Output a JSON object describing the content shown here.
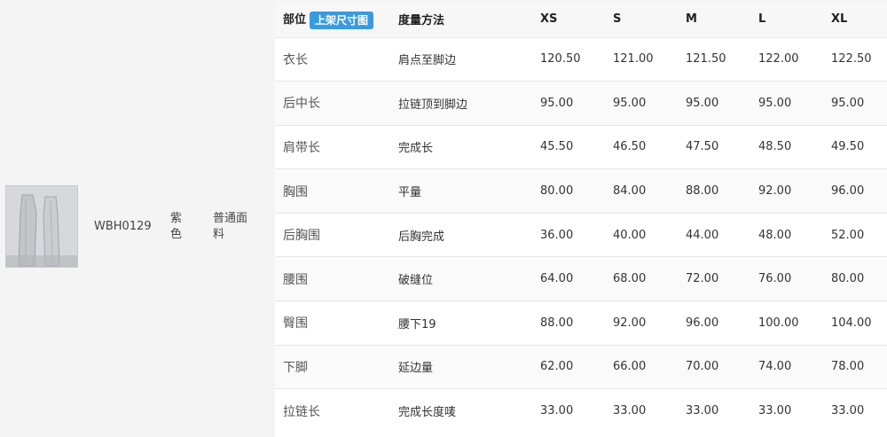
{
  "product": {
    "sku": "WBH0129",
    "color": "紫色",
    "fabric": "普通面料"
  },
  "size_table": {
    "header": {
      "part": "部位",
      "badge": "上架尺寸图",
      "method": "度量方法",
      "sizes": [
        "XS",
        "S",
        "M",
        "L",
        "XL"
      ]
    },
    "rows": [
      {
        "part": "衣长",
        "method": "肩点至脚边",
        "values": [
          "120.50",
          "121.00",
          "121.50",
          "122.00",
          "122.50"
        ]
      },
      {
        "part": "后中长",
        "method": "拉链顶到脚边",
        "values": [
          "95.00",
          "95.00",
          "95.00",
          "95.00",
          "95.00"
        ]
      },
      {
        "part": "肩带长",
        "method": "完成长",
        "values": [
          "45.50",
          "46.50",
          "47.50",
          "48.50",
          "49.50"
        ]
      },
      {
        "part": "胸围",
        "method": "平量",
        "values": [
          "80.00",
          "84.00",
          "88.00",
          "92.00",
          "96.00"
        ]
      },
      {
        "part": "后胸围",
        "method": "后胸完成",
        "values": [
          "36.00",
          "40.00",
          "44.00",
          "48.00",
          "52.00"
        ]
      },
      {
        "part": "腰围",
        "method": "破缝位",
        "values": [
          "64.00",
          "68.00",
          "72.00",
          "76.00",
          "80.00"
        ]
      },
      {
        "part": "臀围",
        "method": "腰下19",
        "values": [
          "88.00",
          "92.00",
          "96.00",
          "100.00",
          "104.00"
        ]
      },
      {
        "part": "下脚",
        "method": "延边量",
        "values": [
          "62.00",
          "66.00",
          "70.00",
          "74.00",
          "78.00"
        ]
      },
      {
        "part": "拉链长",
        "method": "完成长度唛",
        "values": [
          "33.00",
          "33.00",
          "33.00",
          "33.00",
          "33.00"
        ]
      }
    ]
  }
}
